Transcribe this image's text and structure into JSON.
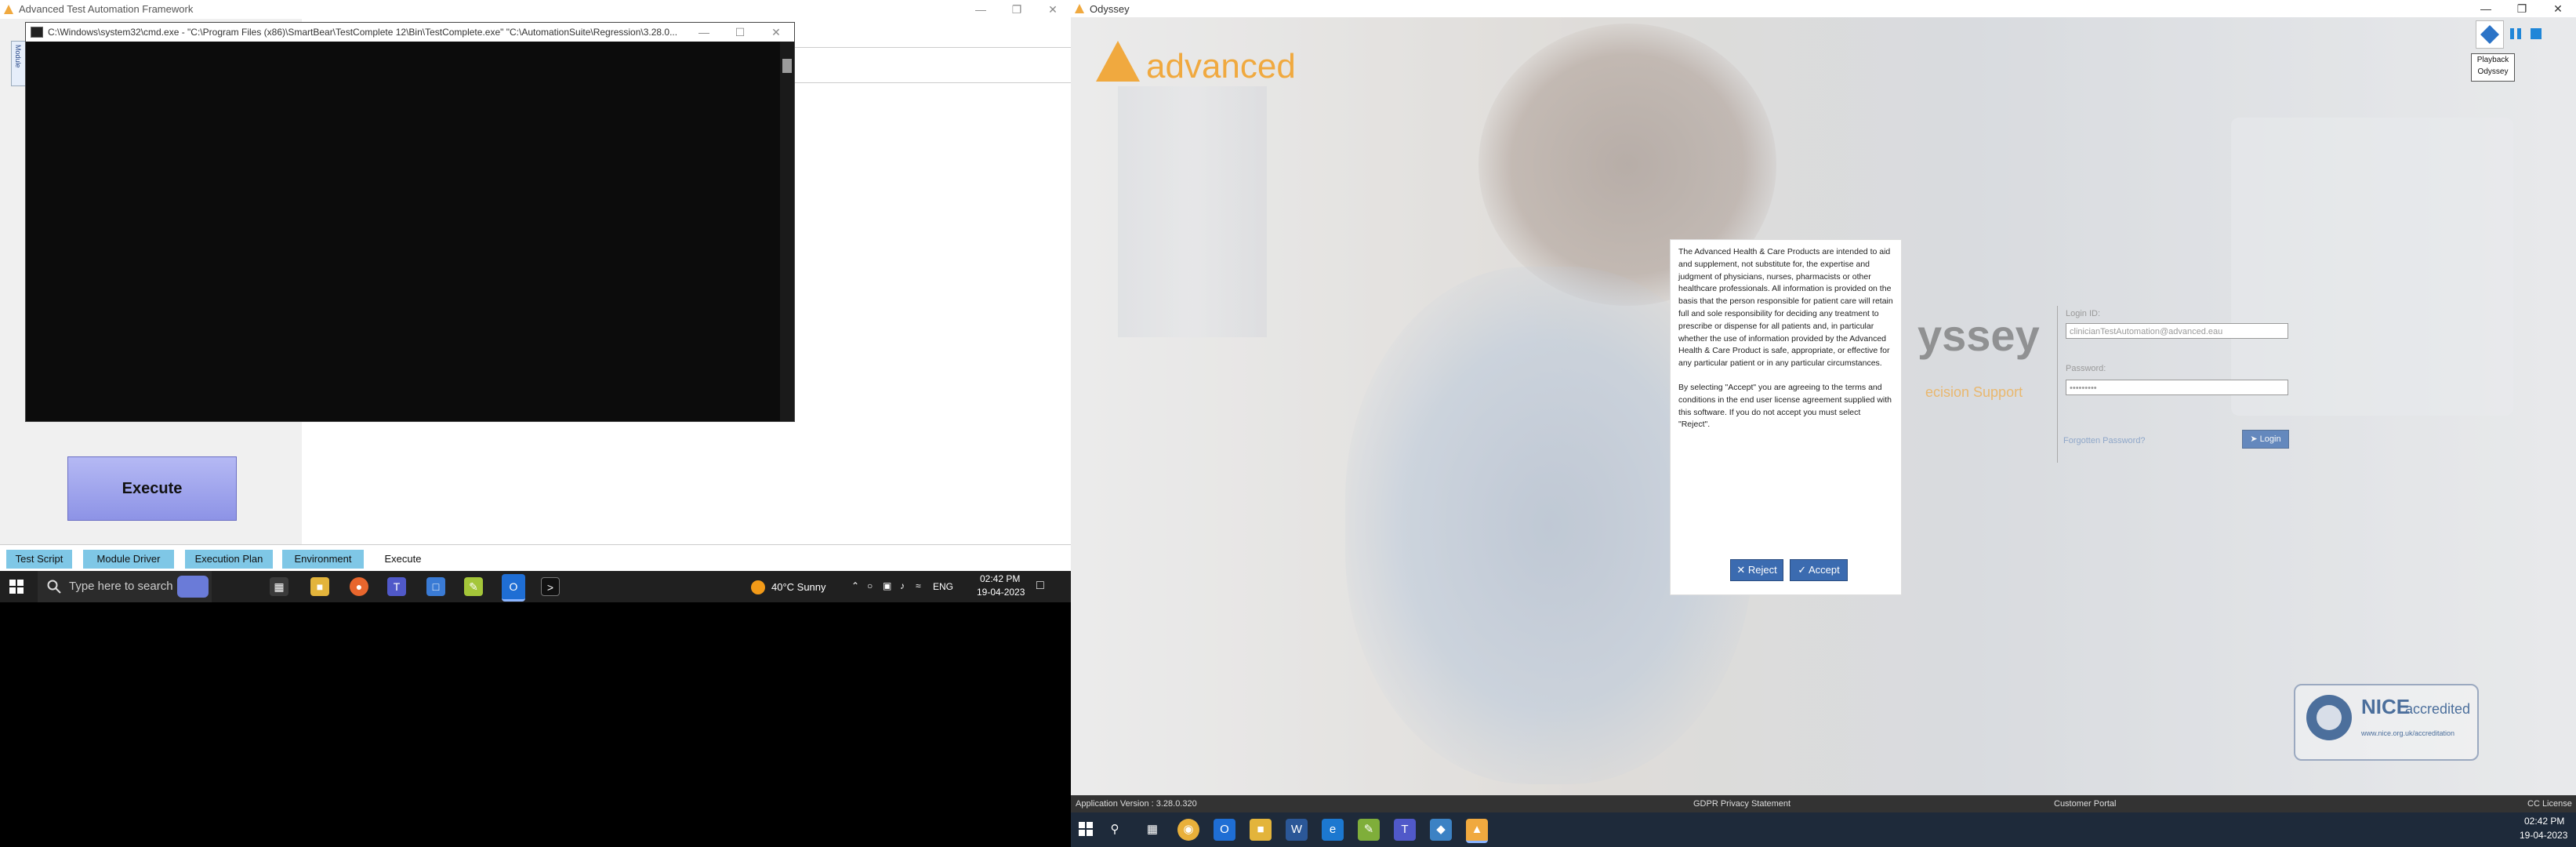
{
  "left": {
    "atf": {
      "title": "Advanced Test Automation Framework",
      "vertical_tab": "Module"
    },
    "cmd": {
      "title": "C:\\Windows\\system32\\cmd.exe - \"C:\\Program Files (x86)\\SmartBear\\TestComplete 12\\Bin\\TestComplete.exe\" \"C:\\AutomationSuite\\Regression\\3.28.0..."
    },
    "execute_label": "Execute",
    "tabs": [
      {
        "label": "Test Script"
      },
      {
        "label": "Module Driver"
      },
      {
        "label": "Execution Plan"
      },
      {
        "label": "Environment"
      },
      {
        "label": "Execute"
      }
    ],
    "taskbar": {
      "search_placeholder": "Type here to search",
      "weather": "40°C  Sunny",
      "lang": "ENG",
      "time": "02:42 PM",
      "date": "19-04-2023"
    }
  },
  "right": {
    "title": "Odyssey",
    "logo": "advanced",
    "brand_partial": "yssey",
    "tagline_partial": "ecision Support",
    "login": {
      "id_label": "Login ID:",
      "id_value": "clinicianTestAutomation@advanced.eau",
      "pw_label": "Password:",
      "pw_value": "•••••••••",
      "forgot": "Forgotten Password?",
      "login_btn": "Login"
    },
    "disclaimer": {
      "para1": "The Advanced Health & Care Products are intended to aid and supplement, not substitute for, the expertise and judgment of physicians, nurses, pharmacists or other healthcare professionals. All information is provided on the basis that the person responsible for patient care will retain full and sole responsibility for deciding any treatment to prescribe or dispense for all patients and, in particular whether the use of information provided by the Advanced Health & Care Product is safe, appropriate, or effective for any particular patient or in any particular circumstances.",
      "para2": "By selecting \"Accept\" you are agreeing to the terms and conditions in the end user license agreement supplied with this software. If you do not accept you must select \"Reject\".",
      "reject": "Reject",
      "accept": "Accept"
    },
    "tooltip_line1": "Playback",
    "tooltip_line2": "Odyssey",
    "nice": {
      "name": "NICE",
      "accredited": "accredited",
      "url": "www.nice.org.uk/accreditation"
    },
    "status": {
      "version": "Application Version : 3.28.0.320",
      "gdpr": "GDPR Privacy Statement",
      "portal": "Customer Portal",
      "license": "CC License"
    },
    "taskbar": {
      "time": "02:42 PM",
      "date": "19-04-2023"
    }
  }
}
